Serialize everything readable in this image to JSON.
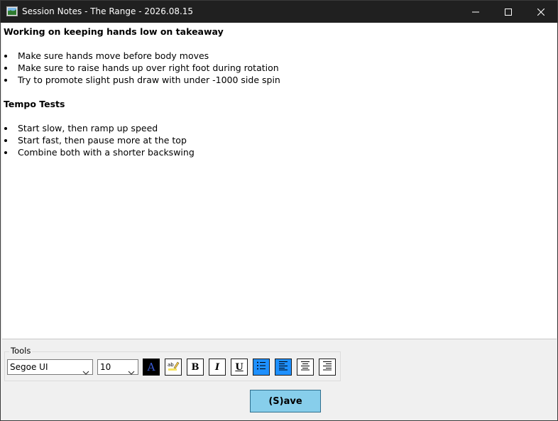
{
  "window": {
    "title": "Session Notes - The Range - 2026.08.15",
    "icon": "app-window-icon"
  },
  "window_controls": {
    "minimize_icon": "minimize-icon",
    "maximize_icon": "maximize-icon",
    "close_icon": "close-icon"
  },
  "notes": {
    "heading1": "Working on keeping hands low on takeaway",
    "list1": [
      "Make sure hands move before body moves",
      "Make sure to raise hands up over right foot during rotation",
      "Try to promote slight push draw with under -1000 side spin"
    ],
    "heading2": "Tempo Tests",
    "list2": [
      "Start slow, then ramp up speed",
      "Start fast, then pause more at the top",
      "Combine both with a shorter backswing"
    ]
  },
  "tools": {
    "label": "Tools",
    "font": "Segoe UI",
    "size": "10",
    "color_button_glyph": "A",
    "bold_glyph": "B",
    "italic_glyph": "I",
    "underline_glyph": "U",
    "active_color": "#1e90ff",
    "text_color_swatch": "#000000"
  },
  "save": {
    "label": "(S)ave",
    "color": "#87ceeb"
  }
}
